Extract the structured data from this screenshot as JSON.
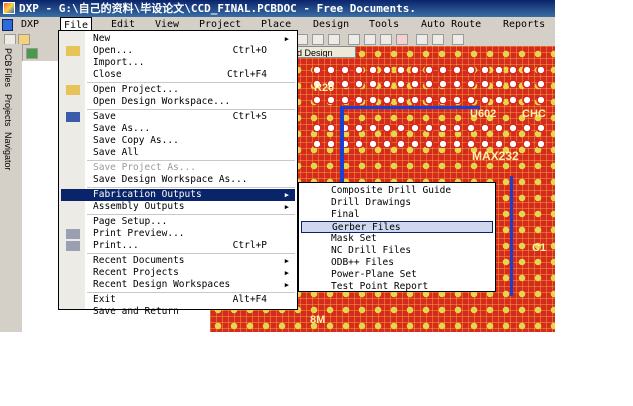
{
  "window": {
    "title": "DXP - G:\\自己的资料\\毕设论文\\CCD_FINAL.PCBDOC - Free Documents."
  },
  "menubar": [
    "DXP",
    "File",
    "Edit",
    "View",
    "Project",
    "Place",
    "Design",
    "Tools",
    "Auto Route",
    "Reports"
  ],
  "side_tabs": [
    "PCB",
    "Files",
    "Projects",
    "Navigator"
  ],
  "doc_tab": "ard Design",
  "pcb_labels": [
    "R20",
    "U602",
    "CHC",
    "MAX232",
    "C1",
    "8M"
  ],
  "file_menu": [
    {
      "label": "New",
      "shortcut": "",
      "submenu": true
    },
    {
      "label": "Open...",
      "shortcut": "Ctrl+O",
      "icon": "open-folder-icon"
    },
    {
      "label": "Import...",
      "shortcut": ""
    },
    {
      "label": "Close",
      "shortcut": "Ctrl+F4"
    },
    {
      "sep": true
    },
    {
      "label": "Open Project...",
      "shortcut": "",
      "icon": "open-project-icon"
    },
    {
      "label": "Open Design Workspace...",
      "shortcut": ""
    },
    {
      "sep": true
    },
    {
      "label": "Save",
      "shortcut": "Ctrl+S",
      "icon": "save-disk-icon"
    },
    {
      "label": "Save As...",
      "shortcut": ""
    },
    {
      "label": "Save Copy As...",
      "shortcut": ""
    },
    {
      "label": "Save All",
      "shortcut": ""
    },
    {
      "sep": true
    },
    {
      "label": "Save Project As...",
      "shortcut": "",
      "disabled": true
    },
    {
      "label": "Save Design Workspace As...",
      "shortcut": ""
    },
    {
      "sep": true
    },
    {
      "label": "Fabrication Outputs",
      "shortcut": "",
      "submenu": true,
      "highlighted": true
    },
    {
      "label": "Assembly Outputs",
      "shortcut": "",
      "submenu": true
    },
    {
      "sep": true
    },
    {
      "label": "Page Setup...",
      "shortcut": ""
    },
    {
      "label": "Print Preview...",
      "shortcut": "",
      "icon": "print-preview-icon"
    },
    {
      "label": "Print...",
      "shortcut": "Ctrl+P",
      "icon": "printer-icon"
    },
    {
      "sep": true
    },
    {
      "label": "Recent Documents",
      "shortcut": "",
      "submenu": true
    },
    {
      "label": "Recent Projects",
      "shortcut": "",
      "submenu": true
    },
    {
      "label": "Recent Design Workspaces",
      "shortcut": "",
      "submenu": true
    },
    {
      "sep": true
    },
    {
      "label": "Exit",
      "shortcut": "Alt+F4"
    },
    {
      "label": "Save and Return",
      "shortcut": ""
    }
  ],
  "fabrication_submenu": [
    {
      "label": "Composite Drill Guide"
    },
    {
      "label": "Drill Drawings"
    },
    {
      "label": "Final"
    },
    {
      "label": "Gerber Files",
      "highlighted": true
    },
    {
      "label": "Mask Set"
    },
    {
      "label": "NC Drill Files"
    },
    {
      "label": "ODB++ Files"
    },
    {
      "label": "Power-Plane Set"
    },
    {
      "label": "Test Point Report"
    }
  ]
}
